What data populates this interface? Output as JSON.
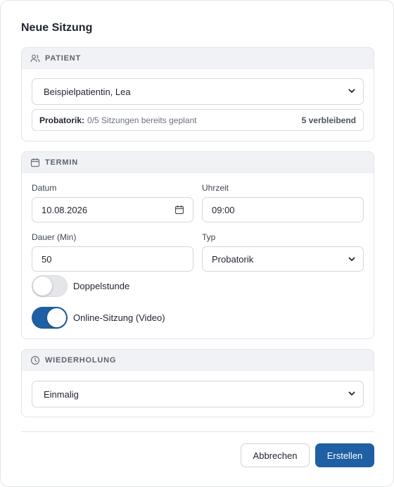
{
  "dialog": {
    "title": "Neue Sitzung"
  },
  "patient_section": {
    "heading": "PATIENT",
    "selected_patient": "Beispielpatientin, Lea",
    "info_lead": "Probatorik:",
    "info_text": "0/5 Sitzungen bereits geplant",
    "info_remaining": "5 verbleibend"
  },
  "termin_section": {
    "heading": "TERMIN",
    "date_label": "Datum",
    "date_value": "10.08.2026",
    "time_label": "Uhrzeit",
    "time_value": "09:00",
    "duration_label": "Dauer (Min)",
    "duration_value": "50",
    "type_label": "Typ",
    "type_value": "Probatorik",
    "double_session_label": "Doppelstunde",
    "double_session_on": false,
    "online_label": "Online-Sitzung (Video)",
    "online_on": true
  },
  "repeat_section": {
    "heading": "WIEDERHOLUNG",
    "selected": "Einmalig"
  },
  "footer": {
    "cancel_label": "Abbrechen",
    "create_label": "Erstellen"
  },
  "colors": {
    "primary": "#1f5fa3",
    "section_header_bg": "#f1f2f5"
  },
  "icons": {
    "patient": "users-icon",
    "termin": "calendar-icon",
    "repeat": "clock-icon",
    "select": "chevron-down-icon"
  }
}
